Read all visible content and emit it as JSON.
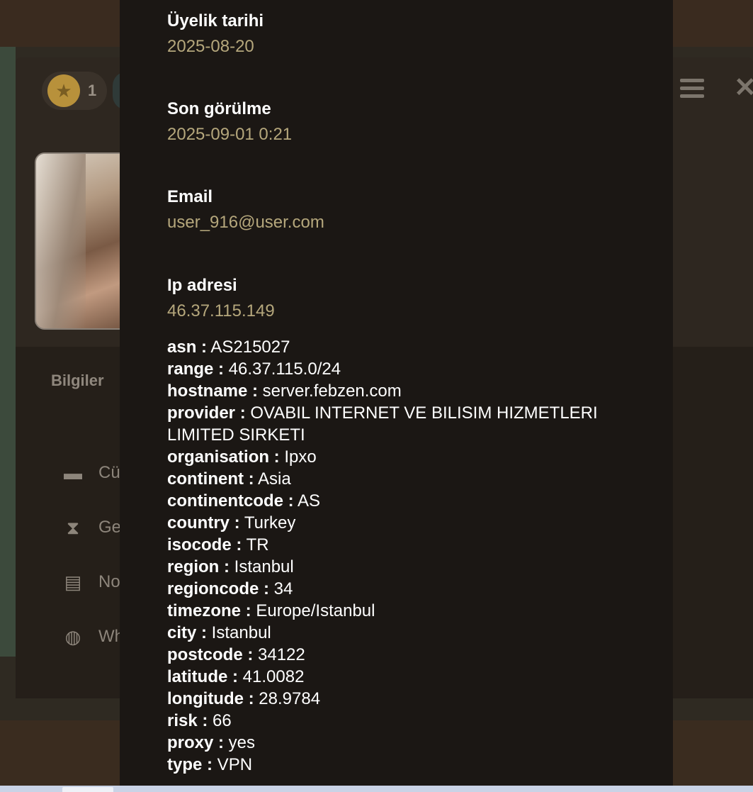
{
  "badge": {
    "count": "1"
  },
  "tabs": {
    "active_label": "Bilgiler"
  },
  "sidebar": {
    "items": [
      {
        "icon": "wallet-icon",
        "label": "Cü"
      },
      {
        "icon": "hourglass-icon",
        "label": "Ge"
      },
      {
        "icon": "document-icon",
        "label": "No"
      },
      {
        "icon": "globe-icon",
        "label": "Wh"
      }
    ]
  },
  "modal": {
    "membership": {
      "label": "Üyelik tarihi",
      "value": "2025-08-20"
    },
    "last_seen": {
      "label": "Son görülme",
      "value": "2025-09-01 0:21"
    },
    "email": {
      "label": "Email",
      "value": "user_916@user.com"
    },
    "ip": {
      "label": "Ip adresi",
      "value": "46.37.115.149"
    },
    "ip_details": [
      {
        "key": "asn :",
        "value": " AS215027"
      },
      {
        "key": "range :",
        "value": " 46.37.115.0/24"
      },
      {
        "key": "hostname :",
        "value": " server.febzen.com"
      },
      {
        "key": "provider :",
        "value": " OVABIL INTERNET VE BILISIM HIZMETLERI LIMITED SIRKETI"
      },
      {
        "key": "organisation :",
        "value": " Ipxo"
      },
      {
        "key": "continent :",
        "value": " Asia"
      },
      {
        "key": "continentcode :",
        "value": " AS"
      },
      {
        "key": "country :",
        "value": " Turkey"
      },
      {
        "key": "isocode :",
        "value": " TR"
      },
      {
        "key": "region :",
        "value": " Istanbul"
      },
      {
        "key": "regioncode :",
        "value": " 34"
      },
      {
        "key": "timezone :",
        "value": " Europe/Istanbul"
      },
      {
        "key": "city :",
        "value": " Istanbul"
      },
      {
        "key": "postcode :",
        "value": " 34122"
      },
      {
        "key": "latitude :",
        "value": " 41.0082"
      },
      {
        "key": "longitude :",
        "value": " 28.9784"
      },
      {
        "key": "risk :",
        "value": " 66"
      },
      {
        "key": "proxy :",
        "value": " yes"
      },
      {
        "key": "type :",
        "value": " VPN"
      }
    ]
  },
  "colors": {
    "label": "#ffffff",
    "value_gold": "#b5a77c",
    "modal_bg": "#1b1714"
  }
}
